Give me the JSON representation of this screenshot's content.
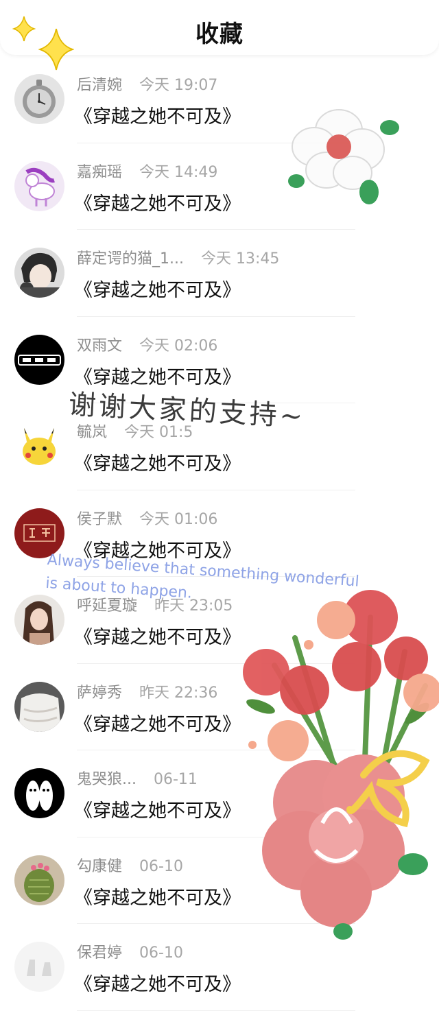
{
  "header": {
    "title": "收藏"
  },
  "items": [
    {
      "name": "后清婉",
      "time": "今天 19:07",
      "title": "《穿越之她不可及》",
      "avatar": "pocket-watch"
    },
    {
      "name": "嘉痴瑶",
      "time": "今天 14:49",
      "title": "《穿越之她不可及》",
      "avatar": "pink-unicorn"
    },
    {
      "name": "薛定谔的猫_1...",
      "time": "今天 13:45",
      "title": "《穿越之她不可及》",
      "avatar": "anime-boy"
    },
    {
      "name": "双雨文",
      "time": "今天 02:06",
      "title": "《穿越之她不可及》",
      "avatar": "black-text-logo"
    },
    {
      "name": "毓岚",
      "time": "今天 01:5",
      "title": "《穿越之她不可及》",
      "avatar": "pikachu"
    },
    {
      "name": "侯子默",
      "time": "今天 01:06",
      "title": "《穿越之她不可及》",
      "avatar": "red-seal"
    },
    {
      "name": "呼延夏璇",
      "time": "昨天 23:05",
      "title": "《穿越之她不可及》",
      "avatar": "girl-portrait"
    },
    {
      "name": "萨婷秀",
      "time": "昨天 22:36",
      "title": "《穿越之她不可及》",
      "avatar": "white-sweater"
    },
    {
      "name": "鬼哭狼...",
      "time": "06-11",
      "title": "《穿越之她不可及》",
      "avatar": "finger-faces"
    },
    {
      "name": "勾康健",
      "time": "06-10",
      "title": "《穿越之她不可及》",
      "avatar": "cactus"
    },
    {
      "name": "保君婷",
      "time": "06-10",
      "title": "《穿越之她不可及》",
      "avatar": "pale-figure"
    }
  ],
  "decorations": {
    "chinese_script": "谢谢大家的支持~",
    "english_line1": "Always believe that something wonderful",
    "english_line2": "is about to happen."
  },
  "colors": {
    "accent_yellow": "#ffe14d",
    "flower_red": "#d9534f",
    "leaf_green": "#3aa05a"
  }
}
